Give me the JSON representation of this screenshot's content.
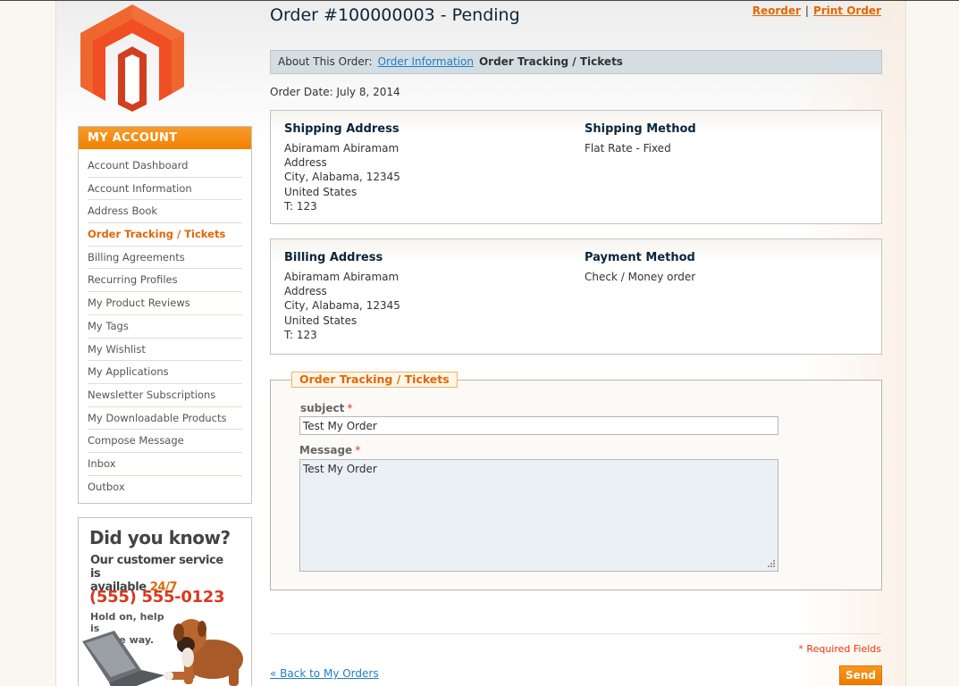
{
  "brand": {
    "accent": "#f18200",
    "link": "#1e7ec8",
    "heading": "#0a263c"
  },
  "header": {
    "title": "Order #100000003 - Pending",
    "links": {
      "reorder": "Reorder",
      "separator": "|",
      "print": "Print Order"
    }
  },
  "sidebar": {
    "title": "MY ACCOUNT",
    "items": [
      {
        "label": "Account Dashboard"
      },
      {
        "label": "Account Information"
      },
      {
        "label": "Address Book"
      },
      {
        "label": "Order Tracking / Tickets",
        "active": true
      },
      {
        "label": "Billing Agreements"
      },
      {
        "label": "Recurring Profiles"
      },
      {
        "label": "My Product Reviews"
      },
      {
        "label": "My Tags"
      },
      {
        "label": "My Wishlist"
      },
      {
        "label": "My Applications"
      },
      {
        "label": "Newsletter Subscriptions"
      },
      {
        "label": "My Downloadable Products"
      },
      {
        "label": "Compose Message"
      },
      {
        "label": "Inbox"
      },
      {
        "label": "Outbox"
      }
    ],
    "promo": {
      "title": "Did you know?",
      "line1": "Our customer service is",
      "line2_prefix": "available ",
      "line2_em": "24/7",
      "phone": "(555) 555-0123",
      "hold1": "Hold on, help is",
      "hold2": "on the way."
    }
  },
  "about": {
    "label": "About This Order:",
    "link": "Order Information",
    "current": "Order Tracking / Tickets"
  },
  "order_date": "Order Date: July 8, 2014",
  "shipping": {
    "address_title": "Shipping Address",
    "address_lines": [
      "Abiramam Abiramam",
      "Address",
      "City, Alabama, 12345",
      "United States",
      "T: 123"
    ],
    "method_title": "Shipping Method",
    "method": "Flat Rate - Fixed"
  },
  "billing": {
    "address_title": "Billing Address",
    "address_lines": [
      "Abiramam Abiramam",
      "Address",
      "City, Alabama, 12345",
      "United States",
      "T: 123"
    ],
    "method_title": "Payment Method",
    "method": "Check / Money order"
  },
  "form": {
    "legend": "Order Tracking / Tickets",
    "subject_label": "subject",
    "subject_value": "Test My Order",
    "message_label": "Message",
    "message_value": "Test My Order",
    "required_mark": "*",
    "required_note": "* Required Fields",
    "back_link": "« Back to My Orders",
    "send": "Send"
  }
}
